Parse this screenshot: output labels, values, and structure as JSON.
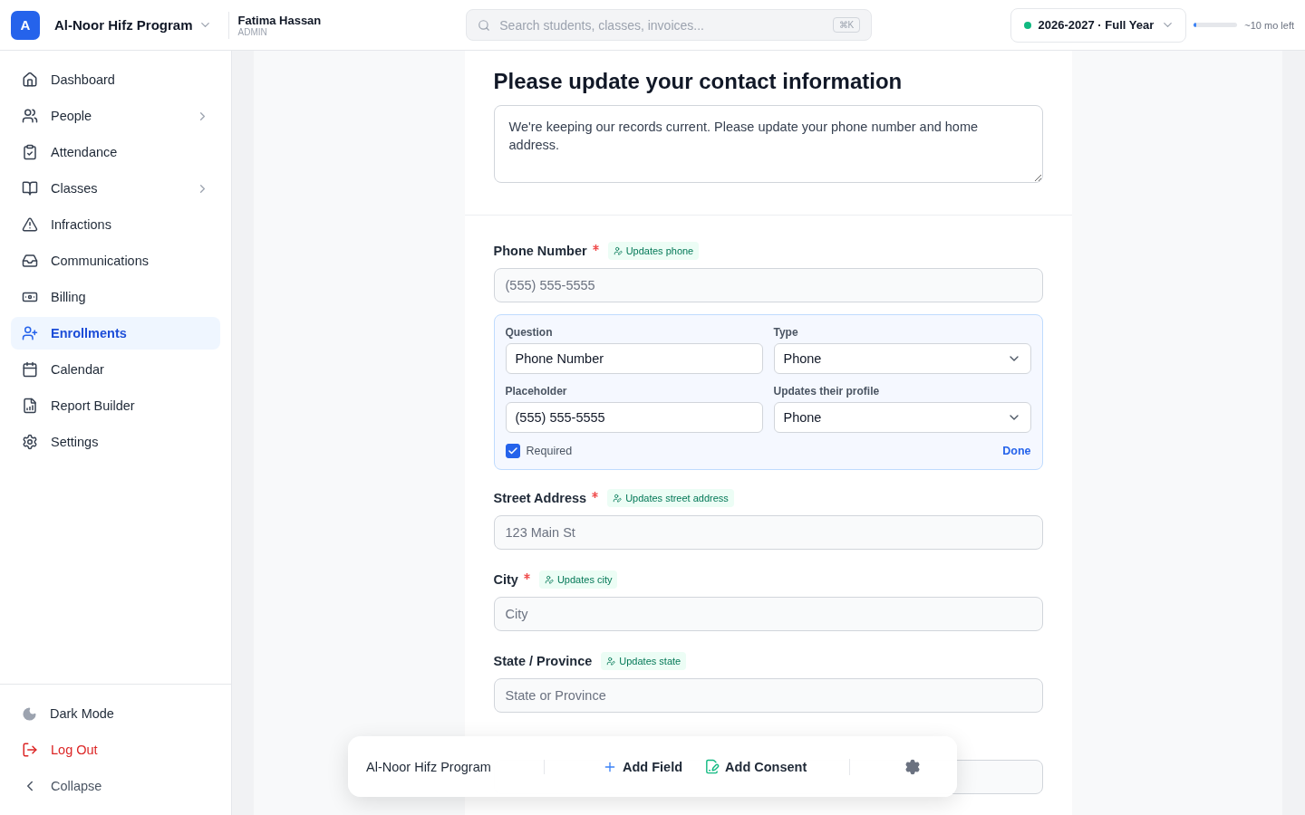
{
  "header": {
    "org_initial": "A",
    "org_name": "Al-Noor Hifz Program",
    "user": {
      "name": "Fatima Hassan",
      "role": "ADMIN"
    },
    "search": {
      "placeholder": "Search students, classes, invoices...",
      "shortcut": "⌘K"
    },
    "term": {
      "label": "2026-2027 · Full Year"
    },
    "term_progress": {
      "level": 0.05,
      "reading": "~10 mo left"
    }
  },
  "sidebar": {
    "items": [
      {
        "label": "Dashboard",
        "selected": false,
        "expandable": false
      },
      {
        "label": "People",
        "selected": false,
        "expandable": true
      },
      {
        "label": "Attendance",
        "selected": false,
        "expandable": false
      },
      {
        "label": "Classes",
        "selected": false,
        "expandable": true
      },
      {
        "label": "Infractions",
        "selected": false,
        "expandable": false
      },
      {
        "label": "Communications",
        "selected": false,
        "expandable": false
      },
      {
        "label": "Billing",
        "selected": false,
        "expandable": false
      },
      {
        "label": "Enrollments",
        "selected": true,
        "expandable": false
      },
      {
        "label": "Calendar",
        "selected": false,
        "expandable": false
      },
      {
        "label": "Report Builder",
        "selected": false,
        "expandable": false
      },
      {
        "label": "Settings",
        "selected": false,
        "expandable": false
      }
    ],
    "footer": [
      {
        "label": "Dark Mode",
        "kind": "theme"
      },
      {
        "label": "Log Out",
        "kind": "logout"
      },
      {
        "label": "Collapse",
        "kind": "collapse"
      }
    ]
  },
  "form": {
    "title": "Please update your contact information",
    "description": "We're keeping our records current. Please update your phone number and home address.",
    "fields": [
      {
        "label": "Phone Number",
        "required": true,
        "badge": "Updates phone",
        "placeholder": "(555) 555-5555",
        "editing": true
      },
      {
        "label": "Street Address",
        "required": true,
        "badge": "Updates street address",
        "placeholder": "123 Main St",
        "editing": false
      },
      {
        "label": "City",
        "required": true,
        "badge": "Updates city",
        "placeholder": "City",
        "editing": false
      },
      {
        "label": "State / Province",
        "required": false,
        "badge": "Updates state",
        "placeholder": "State or Province",
        "editing": false
      }
    ],
    "editor": {
      "question": {
        "label": "Question",
        "value": "Phone Number"
      },
      "type": {
        "label": "Type",
        "value": "Phone"
      },
      "placeholder_setting": {
        "label": "Placeholder",
        "value": "(555) 555-5555"
      },
      "profile": {
        "label": "Updates their profile",
        "value": "Phone"
      },
      "required": {
        "label": "Required",
        "checked": true
      },
      "done": "Done"
    }
  },
  "toolbar": {
    "title": "Al-Noor Hifz Program",
    "actions": [
      {
        "label": "Add Field",
        "kind": "add_field"
      },
      {
        "label": "Add Consent",
        "kind": "add_consent"
      }
    ]
  }
}
